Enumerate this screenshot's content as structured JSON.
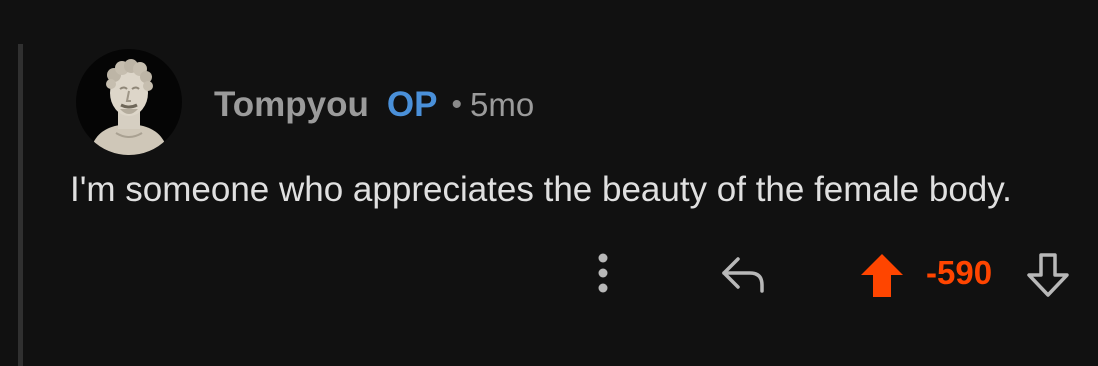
{
  "comment": {
    "username": "Tompyou",
    "op_badge": "OP",
    "separator": "•",
    "age": "5mo",
    "body": "I'm someone who appreciates the beauty of the female body.",
    "score": "-590",
    "vote_state": "upvoted"
  },
  "icons": {
    "avatar": "marble-bust-avatar",
    "more": "vertical-ellipsis-icon",
    "reply": "reply-arrow-icon",
    "upvote": "upvote-arrow-icon",
    "downvote": "downvote-arrow-icon"
  },
  "colors": {
    "background": "#111111",
    "upvote_active": "#ff4500",
    "op_badge": "#4a90d9",
    "text": "#e0e0e0",
    "muted": "#9b9b9b"
  }
}
